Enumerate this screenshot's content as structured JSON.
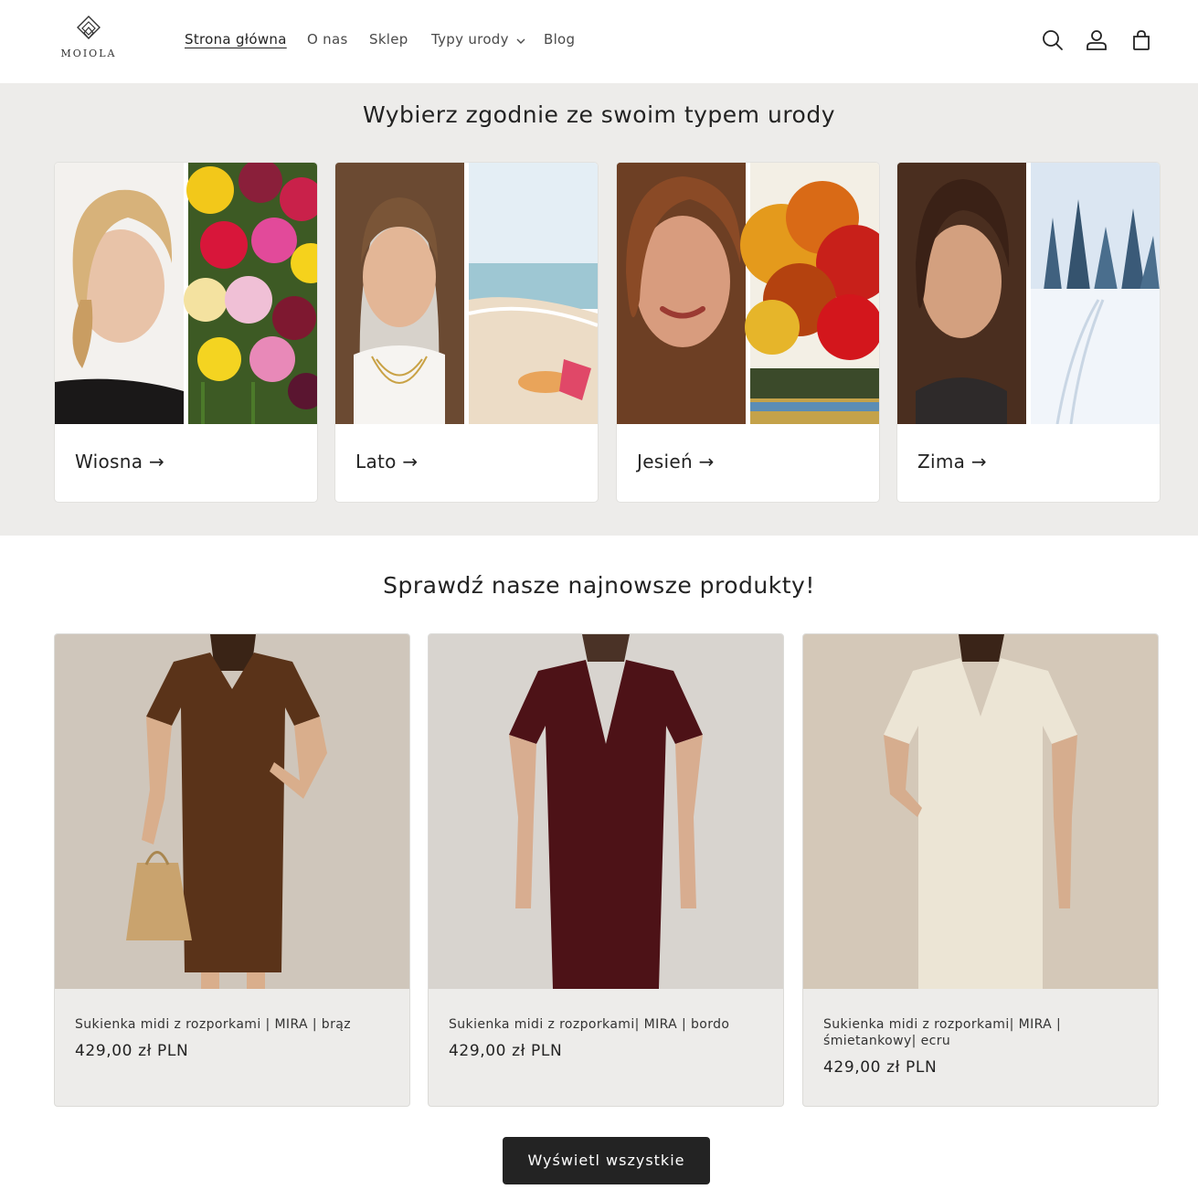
{
  "header": {
    "logo_text": "MOIOLA",
    "nav": [
      {
        "label": "Strona główna",
        "active": true
      },
      {
        "label": "O nas"
      },
      {
        "label": "Sklep"
      },
      {
        "label": "Typy urody",
        "has_dropdown": true
      },
      {
        "label": "Blog"
      }
    ],
    "icons": [
      "search-icon",
      "account-icon",
      "cart-icon"
    ]
  },
  "beauty_types": {
    "title": "Wybierz zgodnie ze swoim typem urody",
    "cards": [
      {
        "label": "Wiosna →",
        "scene": "tulips"
      },
      {
        "label": "Lato →",
        "scene": "beach"
      },
      {
        "label": "Jesień →",
        "scene": "autumn-trees"
      },
      {
        "label": "Zima →",
        "scene": "snowy-forest"
      }
    ]
  },
  "newest": {
    "title": "Sprawdź nasze najnowsze produkty!",
    "products": [
      {
        "title": "Sukienka midi z rozporkami | MIRA | brąz",
        "price": "429,00 zł PLN",
        "dress_color": "#5a3319"
      },
      {
        "title": "Sukienka midi z rozporkami| MIRA | bordo",
        "price": "429,00 zł PLN",
        "dress_color": "#4d1217"
      },
      {
        "title": "Sukienka midi z rozporkami| MIRA | śmietankowy| ecru",
        "price": "429,00 zł PLN",
        "dress_color": "#ece5d5"
      }
    ],
    "view_all_label": "Wyświetl wszystkie"
  },
  "colors": {
    "section_bg": "#edecea",
    "text": "#232323",
    "button_bg": "#232323"
  }
}
